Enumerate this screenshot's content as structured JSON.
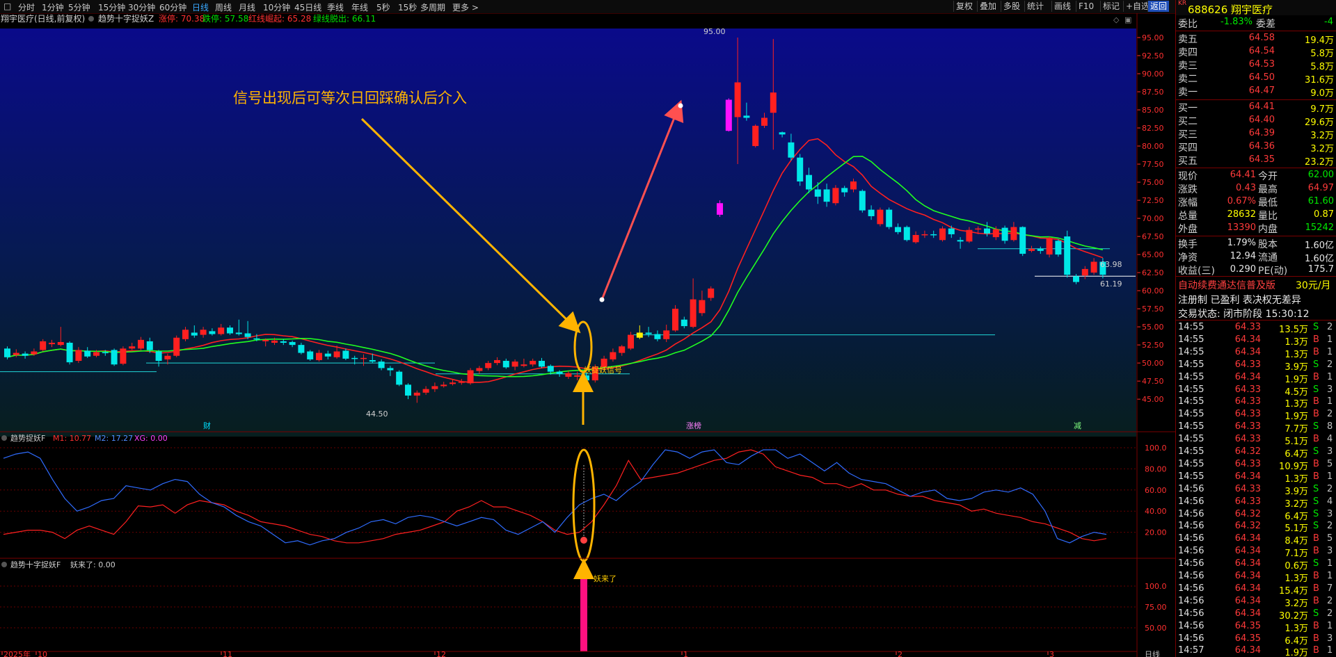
{
  "toolbar": {
    "periods": [
      "分时",
      "1分钟",
      "5分钟",
      "15分钟",
      "30分钟",
      "60分钟",
      "日线",
      "周线",
      "月线",
      "10分钟",
      "45日线",
      "季线",
      "年线",
      "5秒",
      "15秒",
      "多周期",
      "更多 >"
    ],
    "active_period": "日线",
    "right_buttons": [
      "复权",
      "叠加",
      "多股",
      "统计",
      "画线",
      "F10",
      "标记",
      "+自选",
      "返回"
    ]
  },
  "legend": {
    "title": "翔宇医疗(日线,前复权)",
    "indicator": "趋势十字捉妖Z",
    "items": [
      {
        "label": "涨停: 70.38",
        "color": "#ff3030"
      },
      {
        "label": "跌停: 57.58",
        "color": "#00e000"
      },
      {
        "label": "红线崛起: 65.28",
        "color": "#ff3030"
      },
      {
        "label": "绿线脱出: 66.11",
        "color": "#00e000"
      }
    ]
  },
  "annotation": "信号出现后可等次日回踩确认后介入",
  "price_labels": {
    "high": "95.00",
    "low": "44.50",
    "support_a": "63.98",
    "support_b": "61.19",
    "signal": "妖捉妖信号"
  },
  "markers": {
    "m1": "财",
    "m2": "涨榜",
    "m3": "减"
  },
  "y_axis_main": [
    "95.00",
    "92.50",
    "90.00",
    "87.50",
    "85.00",
    "82.50",
    "80.00",
    "77.50",
    "75.00",
    "72.50",
    "70.00",
    "67.50",
    "65.00",
    "62.50",
    "60.00",
    "57.50",
    "55.00",
    "52.50",
    "50.00",
    "47.50",
    "45.00"
  ],
  "osc": {
    "title": "趋势捉妖F",
    "m1": "M1: 10.77",
    "m2": "M2: 17.27",
    "xg": "XG: 0.00",
    "y_axis": [
      "100.0",
      "80.00",
      "60.00",
      "40.00",
      "20.00"
    ]
  },
  "sub3": {
    "title": "趋势十字捉妖F",
    "label": "妖来了: 0.00",
    "bar_label": "妖来了",
    "y_axis": [
      "100.0",
      "75.00",
      "50.00"
    ]
  },
  "x_axis": [
    "2025年",
    "10",
    "11",
    "12",
    "1",
    "2",
    "3"
  ],
  "x_axis_right": "日线",
  "side": {
    "badge": "KR",
    "code_name": "688626 翔宇医疗",
    "webi": {
      "l1": "委比",
      "v1": "-1.83%",
      "l2": "委差",
      "v2": "-4"
    },
    "asks": [
      {
        "label": "卖五",
        "price": "64.58",
        "vol": "19.4万"
      },
      {
        "label": "卖四",
        "price": "64.54",
        "vol": "5.8万"
      },
      {
        "label": "卖三",
        "price": "64.53",
        "vol": "5.8万"
      },
      {
        "label": "卖二",
        "price": "64.50",
        "vol": "31.6万"
      },
      {
        "label": "卖一",
        "price": "64.47",
        "vol": "9.0万"
      }
    ],
    "bids": [
      {
        "label": "买一",
        "price": "64.41",
        "vol": "9.7万"
      },
      {
        "label": "买二",
        "price": "64.40",
        "vol": "29.6万"
      },
      {
        "label": "买三",
        "price": "64.39",
        "vol": "3.2万"
      },
      {
        "label": "买四",
        "price": "64.36",
        "vol": "3.2万"
      },
      {
        "label": "买五",
        "price": "64.35",
        "vol": "23.2万"
      }
    ],
    "quote": [
      {
        "l1": "现价",
        "v1": "64.41",
        "c1": "red",
        "l2": "今开",
        "v2": "62.00",
        "c2": "grn"
      },
      {
        "l1": "涨跌",
        "v1": "0.43",
        "c1": "red",
        "l2": "最高",
        "v2": "64.97",
        "c2": "red"
      },
      {
        "l1": "涨幅",
        "v1": "0.67%",
        "c1": "red",
        "l2": "最低",
        "v2": "61.60",
        "c2": "grn"
      },
      {
        "l1": "总量",
        "v1": "28632",
        "c1": "yel",
        "l2": "量比",
        "v2": "0.87",
        "c2": "yel"
      },
      {
        "l1": "外盘",
        "v1": "13390",
        "c1": "red",
        "l2": "内盘",
        "v2": "15242",
        "c2": "grn"
      }
    ],
    "fund": [
      {
        "l1": "换手",
        "v1": "1.79%",
        "l2": "股本",
        "v2": "1.60亿"
      },
      {
        "l1": "净资",
        "v1": "12.94",
        "l2": "流通",
        "v2": "1.60亿"
      },
      {
        "l1": "收益(三)",
        "v1": "0.290",
        "l2": "PE(动)",
        "v2": "175.7"
      }
    ],
    "promo": "自动续费通达信普及版",
    "promo_price": "30元/月",
    "reg": "注册制 已盈利 表决权无差异",
    "status": "交易状态: 闭市阶段 15:30:12",
    "ticks": [
      {
        "t": "14:55",
        "p": "64.33",
        "v": "13.5万",
        "s": "S",
        "n": "2"
      },
      {
        "t": "14:55",
        "p": "64.34",
        "v": "1.3万",
        "s": "B",
        "n": "1"
      },
      {
        "t": "14:55",
        "p": "64.34",
        "v": "1.3万",
        "s": "B",
        "n": "1"
      },
      {
        "t": "14:55",
        "p": "64.33",
        "v": "3.9万",
        "s": "S",
        "n": "2"
      },
      {
        "t": "14:55",
        "p": "64.34",
        "v": "1.9万",
        "s": "B",
        "n": "1"
      },
      {
        "t": "14:55",
        "p": "64.33",
        "v": "4.5万",
        "s": "S",
        "n": "3"
      },
      {
        "t": "14:55",
        "p": "64.33",
        "v": "1.3万",
        "s": "B",
        "n": "1"
      },
      {
        "t": "14:55",
        "p": "64.33",
        "v": "1.9万",
        "s": "B",
        "n": "2"
      },
      {
        "t": "14:55",
        "p": "64.33",
        "v": "7.7万",
        "s": "S",
        "n": "8"
      },
      {
        "t": "14:55",
        "p": "64.33",
        "v": "5.1万",
        "s": "B",
        "n": "4"
      },
      {
        "t": "14:55",
        "p": "64.32",
        "v": "6.4万",
        "s": "S",
        "n": "3"
      },
      {
        "t": "14:55",
        "p": "64.33",
        "v": "10.9万",
        "s": "B",
        "n": "5"
      },
      {
        "t": "14:55",
        "p": "64.34",
        "v": "1.3万",
        "s": "B",
        "n": "1"
      },
      {
        "t": "14:56",
        "p": "64.33",
        "v": "3.9万",
        "s": "S",
        "n": "2"
      },
      {
        "t": "14:56",
        "p": "64.33",
        "v": "3.2万",
        "s": "S",
        "n": "4"
      },
      {
        "t": "14:56",
        "p": "64.32",
        "v": "6.4万",
        "s": "S",
        "n": "3"
      },
      {
        "t": "14:56",
        "p": "64.32",
        "v": "5.1万",
        "s": "S",
        "n": "2"
      },
      {
        "t": "14:56",
        "p": "64.34",
        "v": "8.4万",
        "s": "B",
        "n": "5"
      },
      {
        "t": "14:56",
        "p": "64.34",
        "v": "7.1万",
        "s": "B",
        "n": "3"
      },
      {
        "t": "14:56",
        "p": "64.34",
        "v": "0.6万",
        "s": "S",
        "n": "1"
      },
      {
        "t": "14:56",
        "p": "64.34",
        "v": "1.3万",
        "s": "B",
        "n": "1"
      },
      {
        "t": "14:56",
        "p": "64.34",
        "v": "15.4万",
        "s": "B",
        "n": "7"
      },
      {
        "t": "14:56",
        "p": "64.34",
        "v": "3.2万",
        "s": "B",
        "n": "2"
      },
      {
        "t": "14:56",
        "p": "64.34",
        "v": "30.2万",
        "s": "S",
        "n": "2"
      },
      {
        "t": "14:56",
        "p": "64.35",
        "v": "1.3万",
        "s": "B",
        "n": "1"
      },
      {
        "t": "14:56",
        "p": "64.35",
        "v": "6.4万",
        "s": "B",
        "n": "3"
      },
      {
        "t": "14:57",
        "p": "64.34",
        "v": "1.9万",
        "s": "B",
        "n": "1"
      }
    ]
  },
  "chart_data": {
    "type": "candlestick",
    "title": "翔宇医疗(日线,前复权)",
    "ylim": [
      43,
      96
    ],
    "candles": [
      [
        52.0,
        50.8,
        52.3,
        50.5
      ],
      [
        51.1,
        51.4,
        51.9,
        50.8
      ],
      [
        51.3,
        51.0,
        51.6,
        50.6
      ],
      [
        51.2,
        51.6,
        52.0,
        51.0
      ],
      [
        51.8,
        53.0,
        53.3,
        51.6
      ],
      [
        52.6,
        52.8,
        53.2,
        52.2
      ],
      [
        52.5,
        52.9,
        55.0,
        52.3
      ],
      [
        52.8,
        50.1,
        53.0,
        49.8
      ],
      [
        50.3,
        51.8,
        52.2,
        50.0
      ],
      [
        51.7,
        50.9,
        52.2,
        50.7
      ],
      [
        51.0,
        51.5,
        51.8,
        50.8
      ],
      [
        51.5,
        51.4,
        51.8,
        51.0
      ],
      [
        51.8,
        49.8,
        52.0,
        49.6
      ],
      [
        49.9,
        52.0,
        52.3,
        49.7
      ],
      [
        52.0,
        52.3,
        52.8,
        51.8
      ],
      [
        52.0,
        53.2,
        53.6,
        51.8
      ],
      [
        53.0,
        51.8,
        53.5,
        51.4
      ],
      [
        51.6,
        50.3,
        51.8,
        49.5
      ],
      [
        50.5,
        51.0,
        51.3,
        49.8
      ],
      [
        51.0,
        53.5,
        53.8,
        50.8
      ],
      [
        53.3,
        54.6,
        55.0,
        53.0
      ],
      [
        54.2,
        53.8,
        55.2,
        53.5
      ],
      [
        53.9,
        54.6,
        55.0,
        53.5
      ],
      [
        54.4,
        54.0,
        54.8,
        53.8
      ],
      [
        54.0,
        54.9,
        55.4,
        53.8
      ],
      [
        54.9,
        54.1,
        55.2,
        53.9
      ],
      [
        54.2,
        54.0,
        56.0,
        53.8
      ],
      [
        54.1,
        53.6,
        55.8,
        53.3
      ],
      [
        53.4,
        53.3,
        54.0,
        53.0
      ],
      [
        53.0,
        53.2,
        53.4,
        52.3
      ],
      [
        52.8,
        53.1,
        53.5,
        52.5
      ],
      [
        53.0,
        52.8,
        53.3,
        52.5
      ],
      [
        52.9,
        52.5,
        53.1,
        52.2
      ],
      [
        52.5,
        51.4,
        52.8,
        51.2
      ],
      [
        51.6,
        50.5,
        51.8,
        50.3
      ],
      [
        50.4,
        51.4,
        51.8,
        50.2
      ],
      [
        51.3,
        50.9,
        51.7,
        50.5
      ],
      [
        50.8,
        51.6,
        52.4,
        50.6
      ],
      [
        51.7,
        50.6,
        52.0,
        50.4
      ],
      [
        50.7,
        50.6,
        51.0,
        49.8
      ],
      [
        50.6,
        50.7,
        51.2,
        49.6
      ],
      [
        50.4,
        50.2,
        51.3,
        50.0
      ],
      [
        50.2,
        49.3,
        50.5,
        49.0
      ],
      [
        49.3,
        49.0,
        49.6,
        48.2
      ],
      [
        48.8,
        47.0,
        49.0,
        46.8
      ],
      [
        47.0,
        45.5,
        47.2,
        45.0
      ],
      [
        45.5,
        45.9,
        46.2,
        44.5
      ],
      [
        45.9,
        46.4,
        46.8,
        45.6
      ],
      [
        46.4,
        46.8,
        47.3,
        46.0
      ],
      [
        46.8,
        47.0,
        47.4,
        46.6
      ],
      [
        47.1,
        47.3,
        47.8,
        46.9
      ],
      [
        47.3,
        47.4,
        47.8,
        47.0
      ],
      [
        47.2,
        49.0,
        49.3,
        47.0
      ],
      [
        48.9,
        49.3,
        49.6,
        48.5
      ],
      [
        49.3,
        50.0,
        50.3,
        49.0
      ],
      [
        50.0,
        50.4,
        50.8,
        49.7
      ],
      [
        50.3,
        49.4,
        50.6,
        49.2
      ],
      [
        49.5,
        50.2,
        50.5,
        49.0
      ],
      [
        49.6,
        49.8,
        50.6,
        49.4
      ],
      [
        49.8,
        50.3,
        50.6,
        49.5
      ],
      [
        50.3,
        49.5,
        50.7,
        49.3
      ],
      [
        49.6,
        48.8,
        49.8,
        48.4
      ],
      [
        48.8,
        48.5,
        49.0,
        48.1
      ],
      [
        48.1,
        48.6,
        48.9,
        47.8
      ],
      [
        48.1,
        48.3,
        48.8,
        47.6
      ],
      [
        48.3,
        47.6,
        48.7,
        47.4
      ],
      [
        47.6,
        49.5,
        49.8,
        47.3
      ],
      [
        49.4,
        50.6,
        51.0,
        49.0
      ],
      [
        50.5,
        51.5,
        52.0,
        50.2
      ],
      [
        51.4,
        52.3,
        52.5,
        51.0
      ],
      [
        52.0,
        53.9,
        54.3,
        51.8
      ],
      [
        53.5,
        54.2,
        55.2,
        53.3
      ],
      [
        54.2,
        54.0,
        55.0,
        53.6
      ],
      [
        54.0,
        53.3,
        54.5,
        53.0
      ],
      [
        53.3,
        54.5,
        55.3,
        52.9
      ],
      [
        54.5,
        57.5,
        58.0,
        54.3
      ],
      [
        56.0,
        55.1,
        56.4,
        54.8
      ],
      [
        55.0,
        58.8,
        61.7,
        54.8
      ],
      [
        56.9,
        58.7,
        60.0,
        56.5
      ],
      [
        59.0,
        60.3,
        60.6,
        58.6
      ],
      [
        72.1,
        70.5,
        72.5,
        70.2
      ],
      [
        86.4,
        82.1,
        86.6,
        82.0
      ],
      [
        84.0,
        88.8,
        95.0,
        77.5
      ],
      [
        84.2,
        83.9,
        86.0,
        83.5
      ],
      [
        80.0,
        82.8,
        83.0,
        79.8
      ],
      [
        82.8,
        83.9,
        84.6,
        82.5
      ],
      [
        84.6,
        87.4,
        94.8,
        79.5
      ],
      [
        81.9,
        81.6,
        82.0,
        81.2
      ],
      [
        80.5,
        78.4,
        81.7,
        78.0
      ],
      [
        78.4,
        75.1,
        78.9,
        74.5
      ],
      [
        76.0,
        74.0,
        77.0,
        73.5
      ],
      [
        74.0,
        73.0,
        75.0,
        72.0
      ],
      [
        74.0,
        72.3,
        74.8,
        71.6
      ],
      [
        72.1,
        74.2,
        74.6,
        71.8
      ],
      [
        74.2,
        73.6,
        74.5,
        73.0
      ],
      [
        74.0,
        75.1,
        75.5,
        73.6
      ],
      [
        73.8,
        71.1,
        74.0,
        70.8
      ],
      [
        71.2,
        70.3,
        71.8,
        69.8
      ],
      [
        69.2,
        71.2,
        71.5,
        68.9
      ],
      [
        71.2,
        68.8,
        71.5,
        68.5
      ],
      [
        68.8,
        68.1,
        69.3,
        67.8
      ],
      [
        68.8,
        67.0,
        69.0,
        66.8
      ],
      [
        66.7,
        67.7,
        68.2,
        66.5
      ],
      [
        67.7,
        67.8,
        68.3,
        67.3
      ],
      [
        67.8,
        67.7,
        68.3,
        67.3
      ],
      [
        67.0,
        68.6,
        68.9,
        66.8
      ],
      [
        68.6,
        67.8,
        69.0,
        67.3
      ],
      [
        67.0,
        66.8,
        67.4,
        65.8
      ],
      [
        66.8,
        68.4,
        68.8,
        66.6
      ],
      [
        68.5,
        68.6,
        68.9,
        67.8
      ],
      [
        68.6,
        67.9,
        69.5,
        67.5
      ],
      [
        67.4,
        68.5,
        68.9,
        67.0
      ],
      [
        68.7,
        66.9,
        69.0,
        66.5
      ],
      [
        67.0,
        68.8,
        69.5,
        66.8
      ],
      [
        68.8,
        65.1,
        68.9,
        64.8
      ],
      [
        65.5,
        65.8,
        66.2,
        65.3
      ],
      [
        65.8,
        65.5,
        66.1,
        65.1
      ],
      [
        65.0,
        67.3,
        67.5,
        64.6
      ],
      [
        66.9,
        65.0,
        67.1,
        64.7
      ],
      [
        67.5,
        62.2,
        68.3,
        61.8
      ],
      [
        62.0,
        61.2,
        62.3,
        60.9
      ],
      [
        62.1,
        63.0,
        63.4,
        61.6
      ],
      [
        62.5,
        64.0,
        64.5,
        62.2
      ],
      [
        64.0,
        62.2,
        64.5,
        61.7
      ]
    ]
  }
}
